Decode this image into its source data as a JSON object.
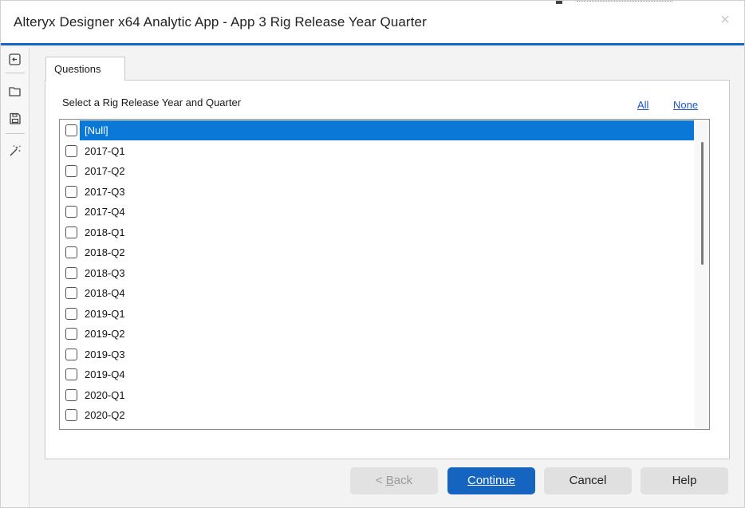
{
  "window": {
    "title": "Alteryx Designer x64 Analytic App - App 3 Rig Release Year Quarter",
    "close_glyph": "×"
  },
  "leftbar": {
    "icons": [
      "collapse-panel-icon",
      "open-folder-icon",
      "save-icon",
      "magic-wand-icon"
    ]
  },
  "tabs": [
    {
      "label": "Questions"
    }
  ],
  "question": {
    "label": "Select a Rig Release Year and Quarter",
    "all_label": "All",
    "none_label": "None"
  },
  "list": {
    "items": [
      {
        "label": "[Null]",
        "selected": true,
        "checked": false
      },
      {
        "label": "2017-Q1",
        "checked": false
      },
      {
        "label": "2017-Q2",
        "checked": false
      },
      {
        "label": "2017-Q3",
        "checked": false
      },
      {
        "label": "2017-Q4",
        "checked": false
      },
      {
        "label": "2018-Q1",
        "checked": false
      },
      {
        "label": "2018-Q2",
        "checked": false
      },
      {
        "label": "2018-Q3",
        "checked": false
      },
      {
        "label": "2018-Q4",
        "checked": false
      },
      {
        "label": "2019-Q1",
        "checked": false
      },
      {
        "label": "2019-Q2",
        "checked": false
      },
      {
        "label": "2019-Q3",
        "checked": false
      },
      {
        "label": "2019-Q4",
        "checked": false
      },
      {
        "label": "2020-Q1",
        "checked": false
      },
      {
        "label": "2020-Q2",
        "checked": false
      }
    ]
  },
  "footer": {
    "back_prefix": "< ",
    "back_accel": "B",
    "back_rest": "ack",
    "continue_accel": "C",
    "continue_rest": "ontinue",
    "cancel_label": "Cancel",
    "help_label": "Help"
  },
  "colors": {
    "accent": "#1565c0",
    "title_border": "#1667c2",
    "selection": "#0a78d7",
    "link": "#1a56c9"
  }
}
